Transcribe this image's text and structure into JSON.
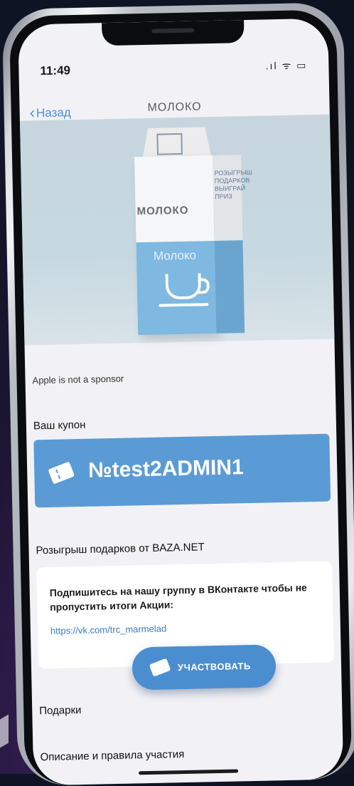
{
  "status": {
    "time": "11:49",
    "icons": ".ıl ᯤ ▭"
  },
  "nav": {
    "back_label": "Назад",
    "title": "МОЛОКО"
  },
  "product": {
    "carton_brand": "МОЛОКО",
    "carton_milk": "Молоко",
    "carton_promo": "РОЗЫГРЫШ ПОДАРКОВ ВЫИГРАЙ ПРИЗ"
  },
  "disclaimer": "Apple is not a sponsor",
  "coupon": {
    "section_title": "Ваш купон",
    "code": "№test2ADMIN1"
  },
  "giveaway": {
    "section_title": "Розыгрыш подарков от BAZA.NET",
    "message": "Подпишитесь на нашу группу в ВКонтакте чтобы не пропустить итоги Акции:",
    "link": "https://vk.com/trc_marmelad",
    "join_label": "УЧАСТВОВАТЬ"
  },
  "sections": {
    "gifts": "Подарки",
    "rules": "Описание и правила участия"
  },
  "colors": {
    "accent": "#5b9bd5",
    "button": "#4b8ed0",
    "link": "#3d7bbf"
  },
  "icons": {
    "back": "chevron-left-icon",
    "coupon": "ticket-icon",
    "join": "ticket-icon"
  }
}
